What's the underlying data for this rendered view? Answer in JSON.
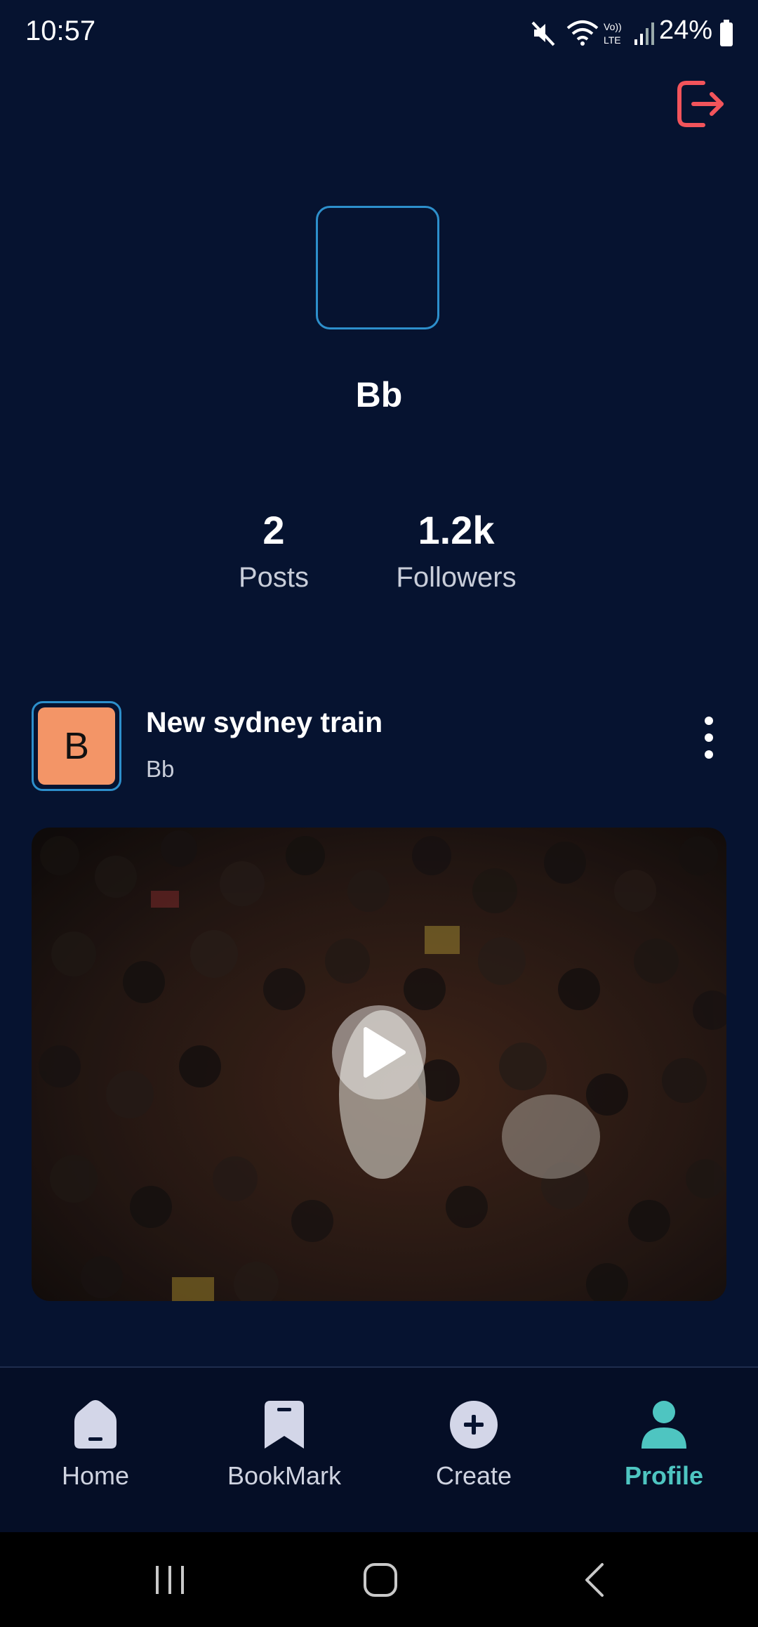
{
  "status_bar": {
    "time": "10:57",
    "battery": "24%"
  },
  "profile": {
    "username": "Bb",
    "stats": {
      "posts_count": "2",
      "posts_label": "Posts",
      "followers_count": "1.2k",
      "followers_label": "Followers"
    }
  },
  "post": {
    "avatar_letter": "B",
    "title": "New sydney train",
    "author": "Bb"
  },
  "bottom_nav": {
    "items": [
      {
        "label": "Home",
        "icon": "home-icon"
      },
      {
        "label": "BookMark",
        "icon": "bookmark-icon"
      },
      {
        "label": "Create",
        "icon": "plus-circle-icon"
      },
      {
        "label": "Profile",
        "icon": "user-icon",
        "active": true
      }
    ]
  },
  "colors": {
    "background": "#061330",
    "accent_active": "#4ec5c1",
    "logout": "#f2545b",
    "avatar_border": "#2d8fcb",
    "post_avatar_fill": "#f39567"
  }
}
